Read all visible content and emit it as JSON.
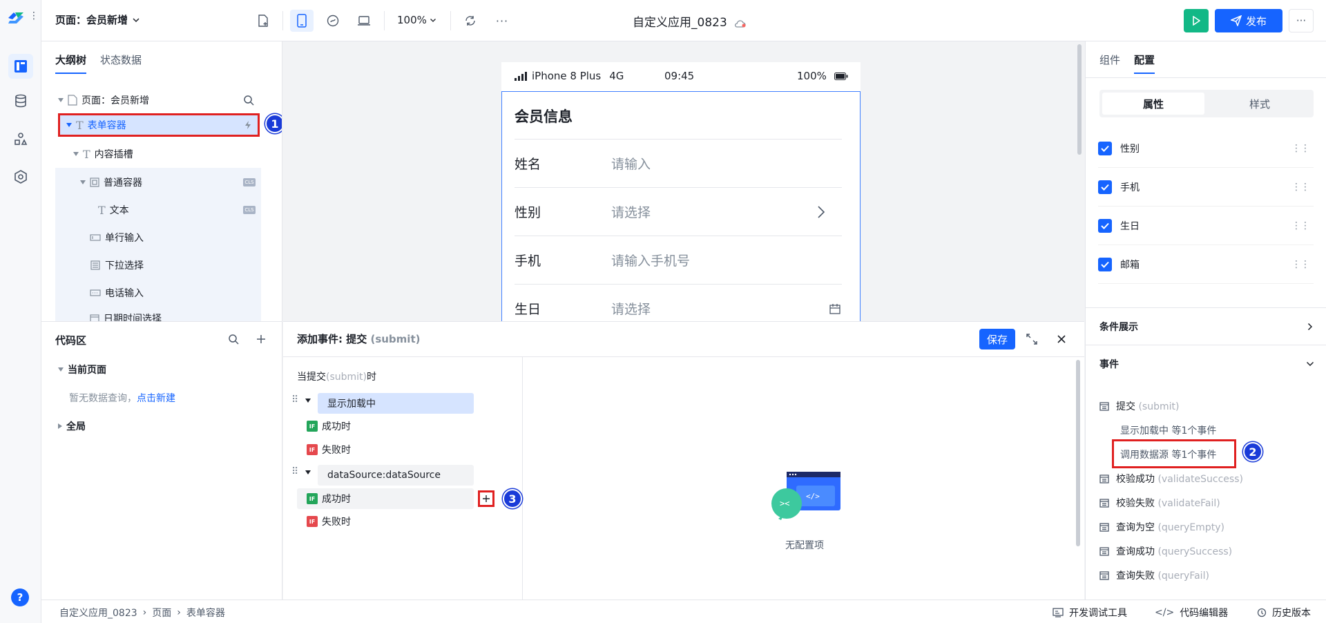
{
  "topbar": {
    "page_selector": "页面：会员新增",
    "zoom": "100%",
    "app_title": "自定义应用_0823",
    "publish_label": "发布"
  },
  "outline": {
    "tabs": [
      "大纲树",
      "状态数据"
    ],
    "tree": [
      {
        "label": "页面：会员新增"
      },
      {
        "label": "表单容器"
      },
      {
        "label": "内容插槽"
      },
      {
        "label": "普通容器",
        "badge": "CLS"
      },
      {
        "label": "文本",
        "badge": "CLS"
      },
      {
        "label": "单行输入"
      },
      {
        "label": "下拉选择"
      },
      {
        "label": "电话输入"
      },
      {
        "label": "日期时间选择"
      }
    ]
  },
  "codearea": {
    "title": "代码区",
    "current_page": "当前页面",
    "empty_text": "暂无数据查询，",
    "create_link": "点击新建",
    "global": "全局"
  },
  "canvas": {
    "device": "iPhone 8 Plus",
    "network": "4G",
    "time": "09:45",
    "battery": "100%",
    "form_title": "会员信息",
    "rows": [
      {
        "label": "姓名",
        "placeholder": "请输入"
      },
      {
        "label": "性别",
        "placeholder": "请选择"
      },
      {
        "label": "手机",
        "placeholder": "请输入手机号"
      },
      {
        "label": "生日",
        "placeholder": "请选择"
      }
    ]
  },
  "event_dialog": {
    "title": "添加事件: 提交",
    "title_en": "(submit)",
    "save_label": "保存",
    "trigger_prefix": "当提交",
    "trigger_en": "(submit)",
    "trigger_suffix": "时",
    "steps": [
      {
        "label": "显示加载中",
        "success": "成功时",
        "fail": "失败时"
      },
      {
        "label": "dataSource:dataSource",
        "success": "成功时",
        "fail": "失败时"
      }
    ],
    "empty_text": "无配置项"
  },
  "right_panel": {
    "tabs": [
      "组件",
      "配置"
    ],
    "segments": [
      "属性",
      "样式"
    ],
    "fields": [
      "性别",
      "手机",
      "生日",
      "邮箱"
    ],
    "condition_title": "条件展示",
    "events_title": "事件",
    "events": [
      {
        "label": "提交",
        "en": "(submit)"
      },
      {
        "label": "校验成功",
        "en": "(validateSuccess)"
      },
      {
        "label": "校验失败",
        "en": "(validateFail)"
      },
      {
        "label": "查询为空",
        "en": "(queryEmpty)"
      },
      {
        "label": "查询成功",
        "en": "(querySuccess)"
      },
      {
        "label": "查询失败",
        "en": "(queryFail)"
      }
    ],
    "submit_subs": [
      "显示加载中 等1个事件",
      "调用数据源 等1个事件"
    ]
  },
  "bottom": {
    "breadcrumb": [
      "自定义应用_0823",
      "页面",
      "表单容器"
    ],
    "devtools": "开发调试工具",
    "code_editor": "代码编辑器",
    "version": "历史版本"
  },
  "callouts": [
    "1",
    "2",
    "3"
  ],
  "colors": {
    "primary": "#1664ff",
    "run": "#12b886",
    "highlight_box": "#e02020",
    "callout": "#1a3bd8"
  }
}
